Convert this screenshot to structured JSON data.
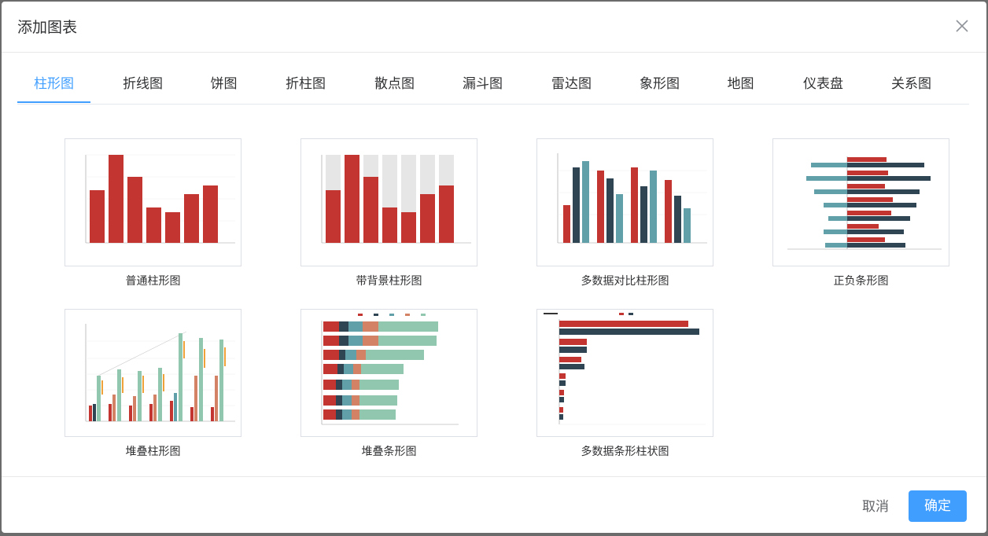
{
  "dialog": {
    "title": "添加图表",
    "close_icon": "close-icon"
  },
  "tabs": [
    {
      "label": "柱形图",
      "active": true
    },
    {
      "label": "折线图"
    },
    {
      "label": "饼图"
    },
    {
      "label": "折柱图"
    },
    {
      "label": "散点图"
    },
    {
      "label": "漏斗图"
    },
    {
      "label": "雷达图"
    },
    {
      "label": "象形图"
    },
    {
      "label": "地图"
    },
    {
      "label": "仪表盘"
    },
    {
      "label": "关系图"
    }
  ],
  "charts": [
    {
      "label": "普通柱形图"
    },
    {
      "label": "带背景柱形图"
    },
    {
      "label": "多数据对比柱形图"
    },
    {
      "label": "正负条形图"
    },
    {
      "label": "堆叠柱形图"
    },
    {
      "label": "堆叠条形图"
    },
    {
      "label": "多数据条形柱状图"
    }
  ],
  "footer": {
    "cancel": "取消",
    "confirm": "确定"
  },
  "colors": {
    "accent": "#409eff",
    "red": "#c23531",
    "navy": "#2f4554",
    "teal": "#61a0a8",
    "orange": "#d48265",
    "mint": "#91c7ae"
  }
}
